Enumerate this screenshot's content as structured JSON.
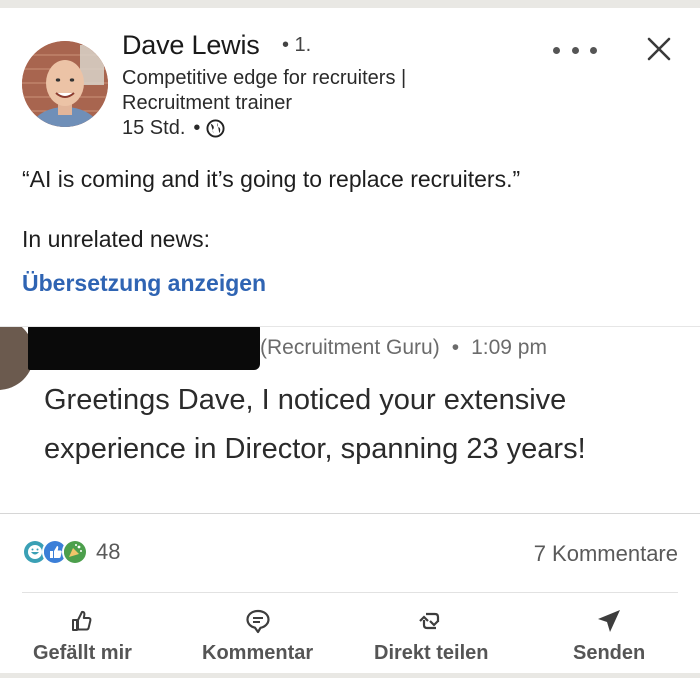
{
  "post": {
    "author_name": "Dave Lewis",
    "degree": "• 1.",
    "headline": "Competitive edge for recruiters | Recruitment trainer",
    "time": "15 Std.",
    "time_sep": "•",
    "visibility_icon": "globe-icon",
    "more_icon": "more-horizontal-icon",
    "close_icon": "close-icon",
    "text_line1": "“AI is coming and it’s going to replace recruiters.”",
    "text_line2": "In unrelated news:",
    "translate_link": "Übersetzung anzeigen"
  },
  "embedded_message": {
    "sender_suffix": "(Recruitment Guru)",
    "separator": "•",
    "time": "1:09 pm",
    "text": "Greetings Dave, I noticed your extensive experience in Director, spanning 23 years!"
  },
  "social": {
    "reaction_icons": [
      "funny-reaction-icon",
      "like-reaction-icon",
      "celebrate-reaction-icon"
    ],
    "reaction_count": "48",
    "comments": "7 Kommentare"
  },
  "actions": [
    {
      "label": "Gefällt mir",
      "icon": "thumbs-up-icon"
    },
    {
      "label": "Kommentar",
      "icon": "comment-icon"
    },
    {
      "label": "Direkt teilen",
      "icon": "repost-icon"
    },
    {
      "label": "Senden",
      "icon": "send-icon"
    }
  ],
  "colors": {
    "link": "#2f64b3",
    "redaction": "#0a0a0a"
  }
}
